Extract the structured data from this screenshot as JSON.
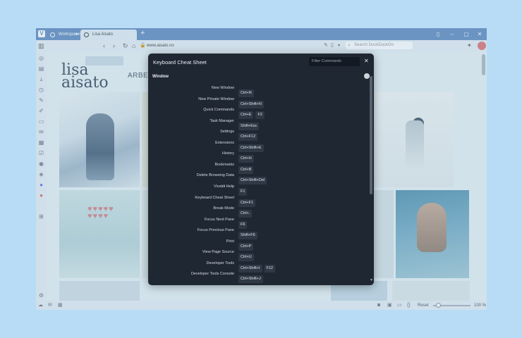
{
  "browser": {
    "tabs": [
      {
        "label": "Workspaces"
      },
      {
        "label": "Lisa Aisato"
      }
    ],
    "url": "www.aisato.no",
    "search_placeholder": "Search DuckDuckGo",
    "status": {
      "reset_label": "Reset",
      "zoom": "100 %"
    }
  },
  "page": {
    "logo_text": "lisa aisato",
    "nav_label": "ARBEID"
  },
  "cheatsheet": {
    "title": "Keyboard Cheat Sheet",
    "filter_placeholder": "Filter Commands",
    "section": "Window",
    "commands": [
      {
        "label": "New Window",
        "keys": [
          "Ctrl+N"
        ]
      },
      {
        "label": "New Private Window",
        "keys": [
          "Ctrl+Shift+N"
        ]
      },
      {
        "label": "Quick Commands",
        "keys": [
          "Ctrl+E",
          "F2"
        ]
      },
      {
        "label": "Task Manager",
        "keys": [
          "Shift+Esc"
        ]
      },
      {
        "label": "Settings",
        "keys": [
          "Ctrl+F12"
        ]
      },
      {
        "label": "Extensions",
        "keys": [
          "Ctrl+Shift+E"
        ]
      },
      {
        "label": "History",
        "keys": [
          "Ctrl+H"
        ]
      },
      {
        "label": "Bookmarks",
        "keys": [
          "Ctrl+B"
        ]
      },
      {
        "label": "Delete Browsing Data",
        "keys": [
          "Ctrl+Shift+Del"
        ]
      },
      {
        "label": "Vivaldi Help",
        "keys": [
          "F1"
        ]
      },
      {
        "label": "Keyboard Cheat Sheet",
        "keys": [
          "Ctrl+F1"
        ]
      },
      {
        "label": "Break Mode",
        "keys": [
          "Ctrl+."
        ]
      },
      {
        "label": "Focus Next Pane",
        "keys": [
          "F6"
        ]
      },
      {
        "label": "Focus Previous Pane",
        "keys": [
          "Shift+F6"
        ]
      },
      {
        "label": "Print",
        "keys": [
          "Ctrl+P"
        ]
      },
      {
        "label": "View Page Source",
        "keys": [
          "Ctrl+U"
        ]
      },
      {
        "label": "Developer Tools",
        "keys": [
          "Ctrl+Shift+I",
          "F12"
        ]
      },
      {
        "label": "Developer Tools Console",
        "keys": [
          "Ctrl+Shift+J"
        ]
      }
    ]
  }
}
